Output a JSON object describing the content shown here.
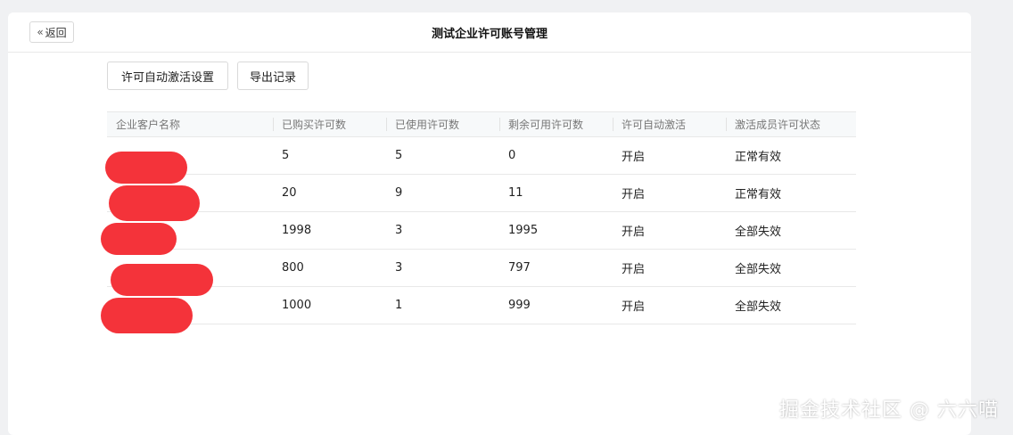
{
  "header": {
    "back_label": "返回",
    "title": "测试企业许可账号管理"
  },
  "toolbar": {
    "settings_label": "许可自动激活设置",
    "export_label": "导出记录"
  },
  "table": {
    "columns": [
      "企业客户名称",
      "已购买许可数",
      "已使用许可数",
      "剩余可用许可数",
      "许可自动激活",
      "激活成员许可状态"
    ],
    "rows": [
      {
        "customer": "",
        "purchased": "5",
        "used": "5",
        "remaining": "0",
        "auto_activate": "开启",
        "status": "正常有效",
        "status_tone": "normal"
      },
      {
        "customer": "",
        "purchased": "20",
        "used": "9",
        "remaining": "11",
        "auto_activate": "开启",
        "status": "正常有效",
        "status_tone": "normal"
      },
      {
        "customer": "",
        "purchased": "1998",
        "used": "3",
        "remaining": "1995",
        "auto_activate": "开启",
        "status": "全部失效",
        "status_tone": "warning"
      },
      {
        "customer": "",
        "purchased": "800",
        "used": "3",
        "remaining": "797",
        "auto_activate": "开启",
        "status": "全部失效",
        "status_tone": "warning"
      },
      {
        "customer": "",
        "purchased": "1000",
        "used": "1",
        "remaining": "999",
        "auto_activate": "开启",
        "status": "全部失效",
        "status_tone": "warning"
      }
    ]
  },
  "colors": {
    "warning_text": "#e08a3a",
    "redaction": "#f4333a"
  },
  "watermark": "掘金技术社区 @ 六六喵"
}
